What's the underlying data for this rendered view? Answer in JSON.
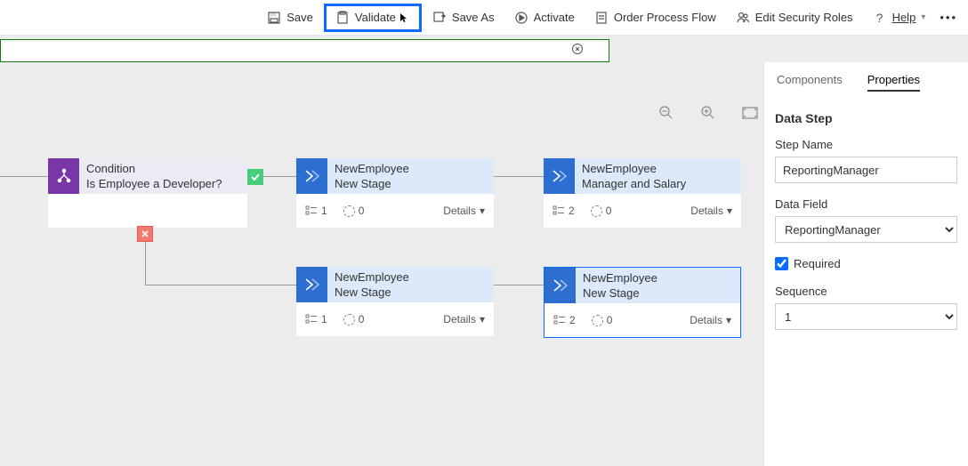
{
  "toolbar": {
    "save": "Save",
    "validate": "Validate",
    "save_as": "Save As",
    "activate": "Activate",
    "order": "Order Process Flow",
    "security": "Edit Security Roles",
    "help": "Help"
  },
  "canvas": {
    "condition": {
      "title": "Condition",
      "subtitle": "Is Employee a Developer?"
    },
    "stages": [
      {
        "entity": "NewEmployee",
        "name": "New Stage",
        "steps": "1",
        "pending": "0",
        "details": "Details"
      },
      {
        "entity": "NewEmployee",
        "name": "Manager and Salary",
        "steps": "2",
        "pending": "0",
        "details": "Details"
      },
      {
        "entity": "NewEmployee",
        "name": "New Stage",
        "steps": "1",
        "pending": "0",
        "details": "Details"
      },
      {
        "entity": "NewEmployee",
        "name": "New Stage",
        "steps": "2",
        "pending": "0",
        "details": "Details"
      }
    ]
  },
  "panel": {
    "tabs": {
      "components": "Components",
      "properties": "Properties"
    },
    "section": "Data Step",
    "step_name_label": "Step Name",
    "step_name_value": "ReportingManager",
    "data_field_label": "Data Field",
    "data_field_value": "ReportingManager",
    "required_label": "Required",
    "sequence_label": "Sequence",
    "sequence_value": "1"
  }
}
